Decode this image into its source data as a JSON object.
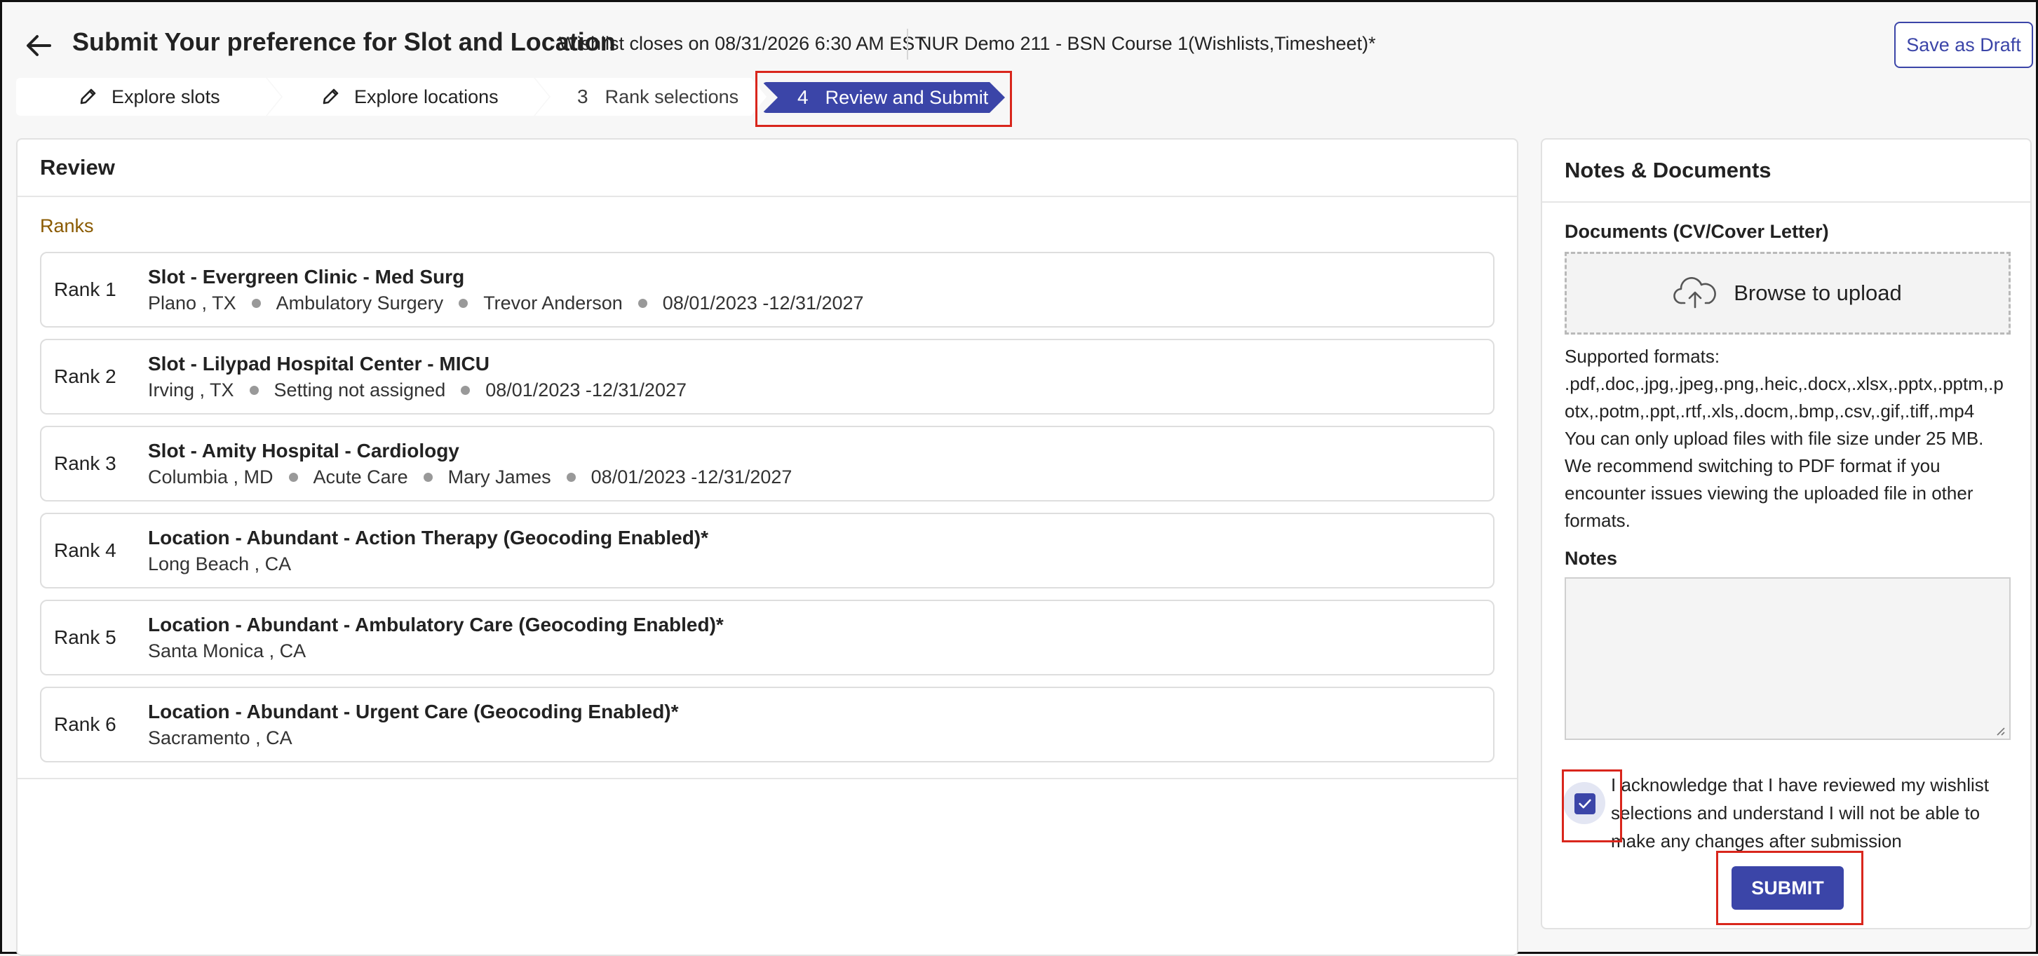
{
  "header": {
    "title": "Submit Your preference for Slot and Location",
    "close_info": "Wishlist closes on 08/31/2026 6:30 AM EST",
    "course": "NUR Demo 211 - BSN Course 1(Wishlists,Timesheet)*",
    "save_draft": "Save as Draft",
    "back_icon": "arrow-left-icon"
  },
  "stepper": {
    "steps": [
      {
        "label": "Explore slots",
        "icon": "pencil-icon"
      },
      {
        "label": "Explore locations",
        "icon": "pencil-icon"
      },
      {
        "number": "3",
        "label": "Rank selections"
      },
      {
        "number": "4",
        "label": "Review and Submit",
        "active": true
      }
    ]
  },
  "review": {
    "title": "Review",
    "ranks_label": "Ranks",
    "ranks": [
      {
        "rank": "Rank 1",
        "title": "Slot - Evergreen Clinic - Med Surg",
        "meta": [
          "Plano , TX",
          "Ambulatory Surgery",
          "Trevor Anderson",
          "08/01/2023 -12/31/2027"
        ]
      },
      {
        "rank": "Rank 2",
        "title": "Slot - Lilypad Hospital Center - MICU",
        "meta": [
          "Irving , TX",
          "Setting not assigned",
          "08/01/2023 -12/31/2027"
        ]
      },
      {
        "rank": "Rank 3",
        "title": "Slot - Amity Hospital - Cardiology",
        "meta": [
          "Columbia , MD",
          "Acute Care",
          "Mary James",
          "08/01/2023 -12/31/2027"
        ]
      },
      {
        "rank": "Rank 4",
        "title": "Location - Abundant - Action Therapy (Geocoding Enabled)*",
        "meta": [
          "Long Beach , CA"
        ]
      },
      {
        "rank": "Rank 5",
        "title": "Location - Abundant - Ambulatory Care (Geocoding Enabled)*",
        "meta": [
          "Santa Monica , CA"
        ]
      },
      {
        "rank": "Rank 6",
        "title": "Location - Abundant - Urgent Care (Geocoding Enabled)*",
        "meta": [
          "Sacramento , CA"
        ]
      }
    ]
  },
  "notes_panel": {
    "title": "Notes & Documents",
    "documents_label": "Documents (CV/Cover Letter)",
    "upload_text": "Browse to upload",
    "upload_icon": "cloud-upload-icon",
    "formats_lines": [
      "Supported formats:",
      ".pdf,.doc,.jpg,.jpeg,.png,.heic,.docx,.xlsx,.pptx,.pptm,.p",
      "otx,.potm,.ppt,.rtf,.xls,.docm,.bmp,.csv,.gif,.tiff,.mp4",
      "You can only upload files with file size under 25 MB.",
      "We recommend switching to PDF format if you",
      "encounter issues viewing the uploaded file in other",
      "formats."
    ],
    "notes_label": "Notes",
    "notes_value": "",
    "acknowledge_lines": [
      "I acknowledge that I have reviewed my wishlist",
      "selections and understand I will not be able to",
      "make any changes after submission"
    ],
    "acknowledge_checked": true,
    "submit": "SUBMIT"
  },
  "colors": {
    "accent": "#3b45a8",
    "highlight": "#d9261c",
    "ranks_label": "#8a5a00"
  }
}
